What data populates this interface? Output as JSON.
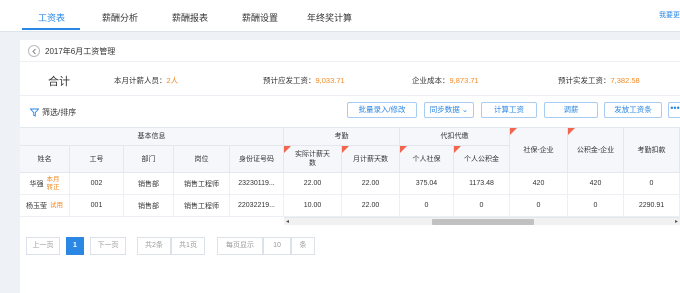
{
  "tabs": [
    {
      "label": "工资表"
    },
    {
      "label": "薪酬分析"
    },
    {
      "label": "薪酬报表"
    },
    {
      "label": "薪酬设置"
    },
    {
      "label": "年终奖计算"
    }
  ],
  "help_link": "我要更",
  "page_title": "2017年6月工资管理",
  "summary": {
    "label": "合计",
    "headcount_label": "本月计薪人员：",
    "headcount_value": "2人",
    "gross_label": "预计应发工资：",
    "gross_value": "9,033.71",
    "cost_label": "企业成本：",
    "cost_value": "9,873.71",
    "net_label": "预计实发工资：",
    "net_value": "7,382.58"
  },
  "toolbar": {
    "filter_label": "筛选/排序",
    "batch_label": "批量录入/修改",
    "sync_label": "同步数据",
    "calc_label": "计算工资",
    "adjust_label": "调薪",
    "pay_label": "发放工资条",
    "more_label": "•••"
  },
  "table": {
    "groups": {
      "basic": "基本信息",
      "attendance": "考勤",
      "withhold": "代扣代缴"
    },
    "columns": {
      "name": "姓名",
      "emp_no": "工号",
      "dept": "部门",
      "position": "岗位",
      "id_no": "身份证号码",
      "actual_days": "实际计薪天数",
      "month_days": "月计薪天数",
      "personal_si": "个人社保",
      "personal_hf": "个人公积金",
      "company_si": "社保-企业",
      "company_hf": "公积金-企业",
      "attendance_deduct": "考勤扣款"
    },
    "rows": [
      {
        "name": "华强",
        "tag": "本月\n转正",
        "emp_no": "002",
        "dept": "销售部",
        "position": "销售工程师",
        "id_no": "23230119...",
        "actual_days": "22.00",
        "month_days": "22.00",
        "personal_si": "375.04",
        "personal_hf": "1173.48",
        "company_si": "420",
        "company_hf": "420",
        "attendance_deduct": "0"
      },
      {
        "name": "杨玉莹",
        "tag": "试用",
        "emp_no": "001",
        "dept": "销售部",
        "position": "销售工程师",
        "id_no": "22032219...",
        "actual_days": "10.00",
        "month_days": "22.00",
        "personal_si": "0",
        "personal_hf": "0",
        "company_si": "0",
        "company_hf": "0",
        "attendance_deduct": "2290.91"
      }
    ]
  },
  "pager": {
    "prev": "上一页",
    "current": "1",
    "next": "下一页",
    "total_items": "共2条",
    "total_pages": "共1页",
    "per_page_label": "每页显示",
    "per_page_value": "10",
    "per_page_unit": "条"
  },
  "colors": {
    "accent": "#2a87e4",
    "highlight": "#f08a24",
    "flag": "#f0664f"
  }
}
